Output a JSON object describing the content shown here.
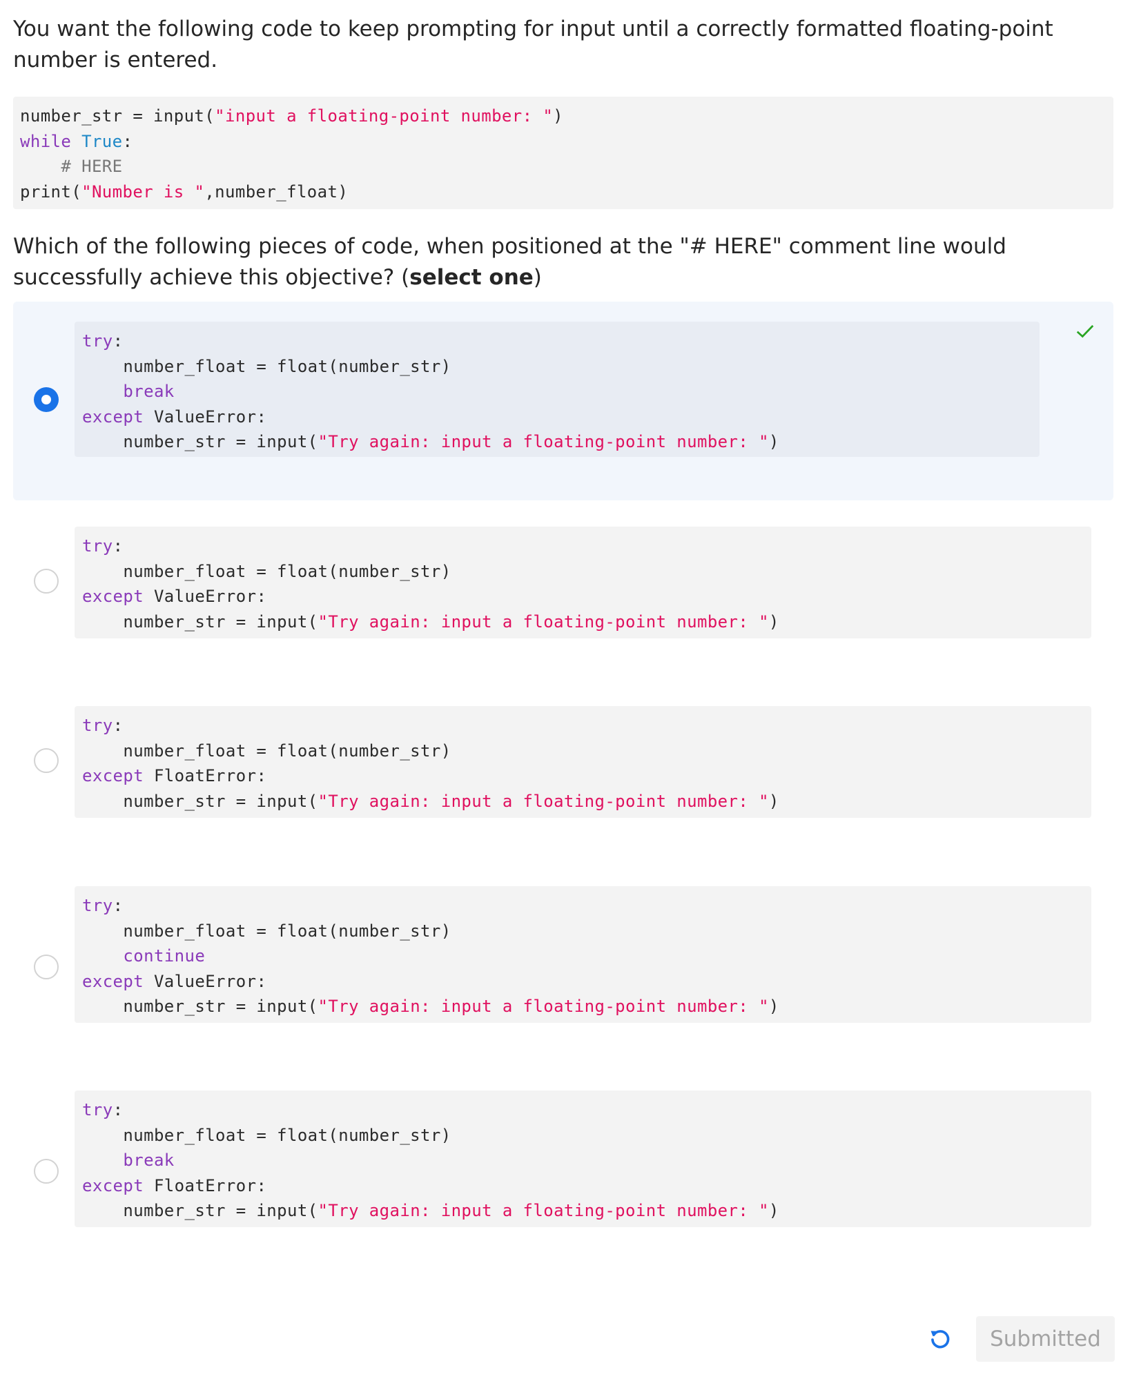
{
  "question": {
    "intro": "You want the following code to keep prompting for input until a correctly formatted floating-point number is entered.",
    "code_lines": [
      [
        [
          "number_str = input(",
          ""
        ],
        [
          "\"input a floating-point number: \"",
          "str"
        ],
        [
          ")",
          ""
        ]
      ],
      [
        [
          "while",
          "kw"
        ],
        [
          " ",
          ""
        ],
        [
          "True",
          "bi"
        ],
        [
          ":",
          ""
        ]
      ],
      [
        [
          "    ",
          ""
        ],
        [
          "# HERE",
          "cm"
        ]
      ],
      [
        [
          "print(",
          ""
        ],
        [
          "\"Number is \"",
          "str"
        ],
        [
          ",number_float)",
          ""
        ]
      ]
    ],
    "prompt_pre": "Which of the following pieces of code, when positioned at the \"# HERE\" comment line would successfully achieve this objective? (",
    "prompt_bold": "select one",
    "prompt_post": ")"
  },
  "options": [
    {
      "selected": true,
      "correct": true,
      "lines": [
        [
          [
            "try",
            "kw"
          ],
          [
            ":",
            ""
          ]
        ],
        [
          [
            "    number_float = float(number_str)",
            ""
          ]
        ],
        [
          [
            "    ",
            ""
          ],
          [
            "break",
            "kw"
          ]
        ],
        [
          [
            "except",
            "kw"
          ],
          [
            " ValueError:",
            ""
          ]
        ],
        [
          [
            "    number_str = input(",
            ""
          ],
          [
            "\"Try again: input a floating-point number: \"",
            "str"
          ],
          [
            ")",
            ""
          ]
        ]
      ]
    },
    {
      "selected": false,
      "lines": [
        [
          [
            "try",
            "kw"
          ],
          [
            ":",
            ""
          ]
        ],
        [
          [
            "    number_float = float(number_str)",
            ""
          ]
        ],
        [
          [
            "except",
            "kw"
          ],
          [
            " ValueError:",
            ""
          ]
        ],
        [
          [
            "    number_str = input(",
            ""
          ],
          [
            "\"Try again: input a floating-point number: \"",
            "str"
          ],
          [
            ")",
            ""
          ]
        ]
      ]
    },
    {
      "selected": false,
      "lines": [
        [
          [
            "try",
            "kw"
          ],
          [
            ":",
            ""
          ]
        ],
        [
          [
            "    number_float = float(number_str)",
            ""
          ]
        ],
        [
          [
            "except",
            "kw"
          ],
          [
            " FloatError:",
            ""
          ]
        ],
        [
          [
            "    number_str = input(",
            ""
          ],
          [
            "\"Try again: input a floating-point number: \"",
            "str"
          ],
          [
            ")",
            ""
          ]
        ]
      ]
    },
    {
      "selected": false,
      "lines": [
        [
          [
            "try",
            "kw"
          ],
          [
            ":",
            ""
          ]
        ],
        [
          [
            "    number_float = float(number_str)",
            ""
          ]
        ],
        [
          [
            "    ",
            ""
          ],
          [
            "continue",
            "kw"
          ]
        ],
        [
          [
            "except",
            "kw"
          ],
          [
            " ValueError:",
            ""
          ]
        ],
        [
          [
            "    number_str = input(",
            ""
          ],
          [
            "\"Try again: input a floating-point number: \"",
            "str"
          ],
          [
            ")",
            ""
          ]
        ]
      ]
    },
    {
      "selected": false,
      "lines": [
        [
          [
            "try",
            "kw"
          ],
          [
            ":",
            ""
          ]
        ],
        [
          [
            "    number_float = float(number_str)",
            ""
          ]
        ],
        [
          [
            "    ",
            ""
          ],
          [
            "break",
            "kw"
          ]
        ],
        [
          [
            "except",
            "kw"
          ],
          [
            " FloatError:",
            ""
          ]
        ],
        [
          [
            "    number_str = input(",
            ""
          ],
          [
            "\"Try again: input a floating-point number: \"",
            "str"
          ],
          [
            ")",
            ""
          ]
        ]
      ]
    }
  ],
  "footer": {
    "reset_icon": "undo-icon",
    "submit_label": "Submitted"
  },
  "colors": {
    "accent": "#1a73e8",
    "keyword": "#8a3ab9",
    "builtin": "#1e88c7",
    "string": "#e0115f",
    "check": "#2aa523"
  }
}
